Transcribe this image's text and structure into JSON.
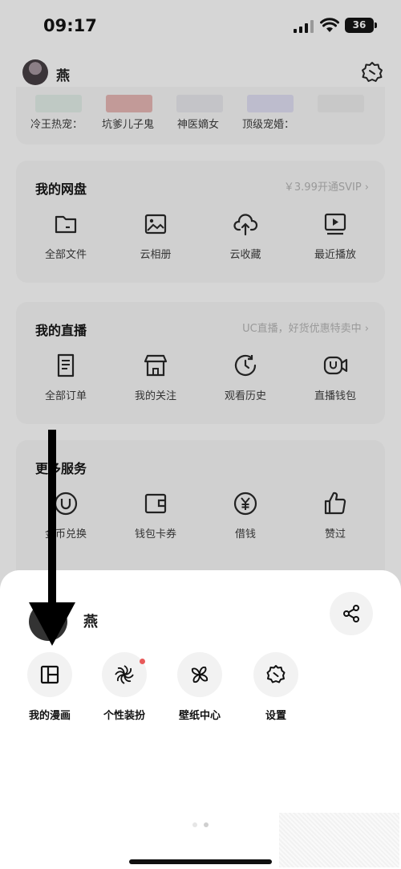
{
  "status": {
    "time": "09:17",
    "battery": "36"
  },
  "header": {
    "name": "燕"
  },
  "recent": {
    "items": [
      "冷王热宠：",
      "坑爹儿子鬼",
      "神医嫡女",
      "顶级宠婚："
    ]
  },
  "netdisk": {
    "title": "我的网盘",
    "link": "￥3.99开通SVIP ›",
    "items": [
      "全部文件",
      "云相册",
      "云收藏",
      "最近播放"
    ]
  },
  "live": {
    "title": "我的直播",
    "link": "UC直播，好货优惠特卖中 ›",
    "items": [
      "全部订单",
      "我的关注",
      "观看历史",
      "直播钱包"
    ]
  },
  "more": {
    "title": "更多服务",
    "items": [
      "金币兑换",
      "钱包卡券",
      "借钱",
      "赞过"
    ]
  },
  "sheet": {
    "name": "燕",
    "actions": [
      "我的漫画",
      "个性装扮",
      "壁纸中心",
      "设置"
    ]
  },
  "colors": {
    "sheet_bg": "#ffffff",
    "dim_bg": "#d6d6d6",
    "badge": "#e85a5a"
  }
}
